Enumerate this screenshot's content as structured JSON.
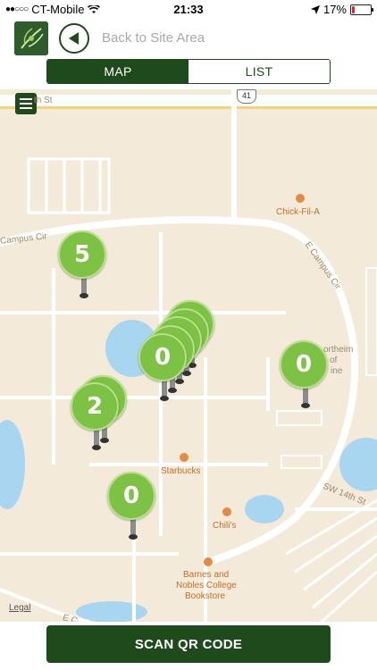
{
  "status_bar": {
    "carrier": "CT-Mobile",
    "time": "21:33",
    "battery": "17%",
    "battery_level": 0.17
  },
  "header": {
    "back_label": "Back to Site Area"
  },
  "tabs": [
    {
      "label": "MAP",
      "active": true
    },
    {
      "label": "LIST",
      "active": false
    }
  ],
  "map": {
    "road_labels": [
      "th St",
      "Campus Cir",
      "E Campus Cir",
      "SW 14th St",
      "E C"
    ],
    "route_shield": "41",
    "pois": [
      "Chick-Fil-A",
      "Starbucks",
      "Chili's",
      "Barnes and",
      "Nobles College",
      "Bookstore"
    ],
    "partial_poi": [
      "ortheim",
      "of",
      "ine"
    ],
    "legal": "Legal",
    "pins": [
      {
        "count": "5"
      },
      {
        "count": "0"
      },
      {
        "count": "2"
      },
      {
        "count": "0"
      },
      {
        "count": "0"
      }
    ]
  },
  "scan_button": "SCAN QR CODE",
  "colors": {
    "brand_green": "#1f4a1c",
    "pin_green": "#7dc244",
    "map_bg": "#f3ead9",
    "water": "#a8d6f0"
  }
}
